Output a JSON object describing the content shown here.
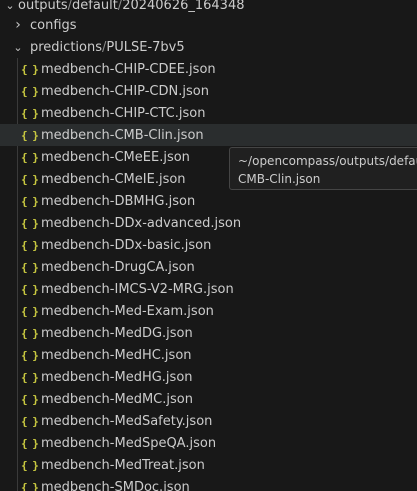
{
  "breadcrumb": {
    "parts": [
      "outputs",
      "default",
      "20240626_164348"
    ],
    "sep": "/"
  },
  "configs": {
    "label": "configs"
  },
  "predictions": {
    "parts": [
      "predictions",
      "PULSE-7bv5"
    ],
    "sep": "/"
  },
  "files": [
    "medbench-CHIP-CDEE.json",
    "medbench-CHIP-CDN.json",
    "medbench-CHIP-CTC.json",
    "medbench-CMB-Clin.json",
    "medbench-CMeEE.json",
    "medbench-CMeIE.json",
    "medbench-DBMHG.json",
    "medbench-DDx-advanced.json",
    "medbench-DDx-basic.json",
    "medbench-DrugCA.json",
    "medbench-IMCS-V2-MRG.json",
    "medbench-Med-Exam.json",
    "medbench-MedDG.json",
    "medbench-MedHC.json",
    "medbench-MedHG.json",
    "medbench-MedMC.json",
    "medbench-MedSafety.json",
    "medbench-MedSpeQA.json",
    "medbench-MedTreat.json",
    "medbench-SMDoc.json"
  ],
  "icon": {
    "glyph": "{ }",
    "name": "json-file-icon",
    "color": "#cbcb41"
  },
  "chevrons": {
    "collapsed": "›",
    "expanded": "⌄"
  },
  "tooltip": {
    "line1": "~/opencompass/outputs/default/",
    "line2": "CMB-Clin.json"
  },
  "selected_index": 3
}
